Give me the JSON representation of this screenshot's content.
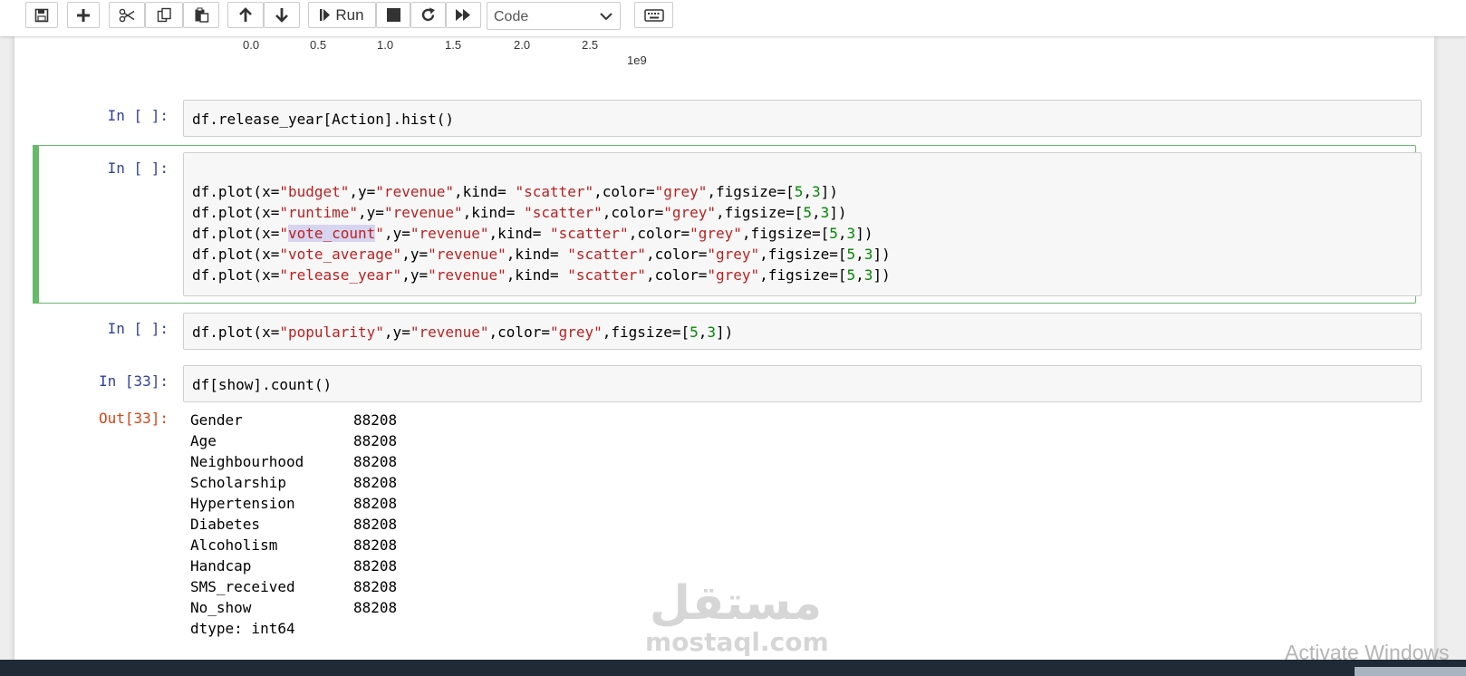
{
  "toolbar": {
    "run_label": "Run",
    "cell_type": "Code"
  },
  "plot_axis": {
    "ticks": [
      "0.0",
      "0.5",
      "1.0",
      "1.5",
      "2.0",
      "2.5"
    ],
    "exponent": "1e9"
  },
  "cells": {
    "c1": {
      "prompt": "In [ ]:",
      "code": "df.release_year[Action].hist()"
    },
    "c2": {
      "prompt": "In [ ]:"
    },
    "c3": {
      "prompt": "In [ ]:"
    },
    "c4": {
      "prompt": "In [33]:",
      "code": "df[show].count()"
    }
  },
  "output": {
    "prompt": "Out[33]:",
    "rows": [
      {
        "label": "Gender",
        "value": "88208"
      },
      {
        "label": "Age",
        "value": "88208"
      },
      {
        "label": "Neighbourhood",
        "value": "88208"
      },
      {
        "label": "Scholarship",
        "value": "88208"
      },
      {
        "label": "Hypertension",
        "value": "88208"
      },
      {
        "label": "Diabetes",
        "value": "88208"
      },
      {
        "label": "Alcoholism",
        "value": "88208"
      },
      {
        "label": "Handcap",
        "value": "88208"
      },
      {
        "label": "SMS_received",
        "value": "88208"
      },
      {
        "label": "No_show",
        "value": "88208"
      }
    ],
    "dtype": "dtype: int64"
  },
  "code_tokens": {
    "df_plot": "df.plot(",
    "x_eq": "x=",
    "y_eq": "y=",
    "comma_y": ",y=",
    "comma_kind": ",kind= ",
    "comma_color": ",color=",
    "comma_figsize": ",figsize=",
    "lbr": "[",
    "comma": ",",
    "close": "])",
    "budget": "\"budget\"",
    "runtime": "\"runtime\"",
    "vote_count": "vote_count",
    "quote": "\"",
    "vote_average": "\"vote_average\"",
    "release_year": "\"release_year\"",
    "popularity": "\"popularity\"",
    "revenue": "\"revenue\"",
    "scatter": "\"scatter\"",
    "grey": "\"grey\"",
    "five": "5",
    "three": "3"
  },
  "watermark": {
    "arabic": "مستقل",
    "latin": "mostaql.com"
  },
  "os_notice": "Activate Windows",
  "colors": {
    "in_prompt": "#303f9f",
    "out_prompt": "#d84315",
    "selected_border": "#66bb6a",
    "string": "#ba2121",
    "number": "#008800"
  }
}
